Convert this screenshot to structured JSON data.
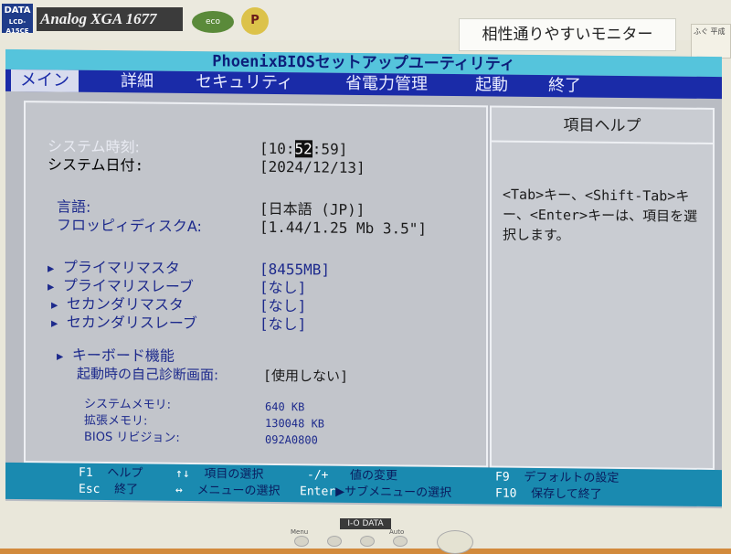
{
  "monitor": {
    "brand_top": "DATA",
    "model_code": "LCD-A15CE",
    "brand_series": "Analog XGA 1677",
    "badge_green": "eco",
    "badge_round": "P",
    "sticker": "相性通りやすいモニター",
    "sticker_small": "ふぐ 平成",
    "bottom_brand": "I-O DATA",
    "buttons": [
      "Menu",
      "",
      "",
      "Auto"
    ]
  },
  "bios": {
    "title": "PhoenixBIOSセットアップユーティリティ",
    "menu": [
      "メイン",
      "詳細",
      "セキュリティ",
      "省電力管理",
      "起動",
      "終了"
    ],
    "active_menu": "メイン",
    "fields": {
      "system_time_label": "システム時刻:",
      "system_time_pre": "[10:",
      "system_time_hl": "52",
      "system_time_post": ":59]",
      "system_date_label": "システム日付:",
      "system_date": "[2024/12/13]",
      "language_label": "言語:",
      "language": "[日本語 (JP)]",
      "floppy_label": "フロッピィディスクA:",
      "floppy": "[1.44/1.25 Mb  3.5\"]",
      "primary_master_label": "プライマリマスタ",
      "primary_master": "[8455MB]",
      "primary_slave_label": "プライマリスレーブ",
      "primary_slave": "[なし]",
      "secondary_master_label": "セカンダリマスタ",
      "secondary_master": "[なし]",
      "secondary_slave_label": "セカンダリスレーブ",
      "secondary_slave": "[なし]",
      "keyboard_label": "キーボード機能",
      "post_screen_label": "起動時の自己診断画面:",
      "post_screen": "[使用しない]",
      "system_memory_label": "システムメモリ:",
      "system_memory": "640 KB",
      "extended_memory_label": "拡張メモリ:",
      "extended_memory": "130048 KB",
      "bios_revision_label": "BIOS リビジョン:",
      "bios_revision": "092A0800"
    },
    "help": {
      "title": "項目ヘルプ",
      "text": "<Tab>キー、<Shift-Tab>キー、<Enter>キーは、項目を選択します。"
    },
    "footer": {
      "f1_key": "F1",
      "f1_desc": "ヘルプ",
      "ud_key": "↑↓",
      "ud_desc": "項目の選択",
      "pm_key": "-/+",
      "pm_desc": "値の変更",
      "f9_key": "F9",
      "f9_desc": "デフォルトの設定",
      "esc_key": "Esc",
      "esc_desc": "終了",
      "lr_key": "↔",
      "lr_desc": "メニューの選択",
      "enter_key": "Enter",
      "enter_desc": "▶サブメニューの選択",
      "f10_key": "F10",
      "f10_desc": "保存して終了"
    }
  }
}
